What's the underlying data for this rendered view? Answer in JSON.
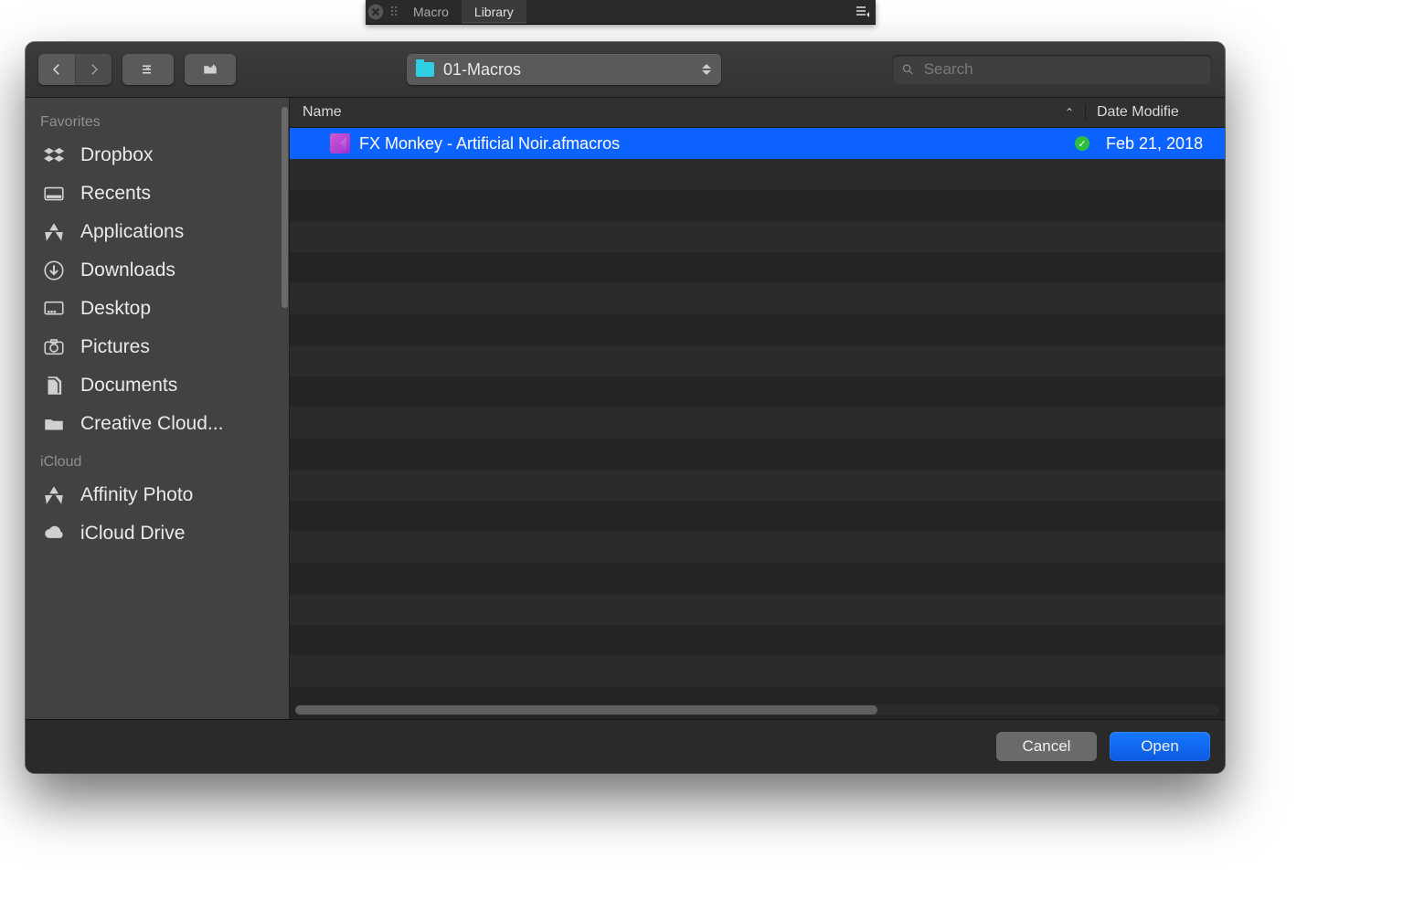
{
  "app_tabs": {
    "items": [
      "Macro",
      "Library"
    ],
    "active_index": 1
  },
  "toolbar": {
    "current_folder": "01-Macros",
    "search_placeholder": "Search"
  },
  "sidebar": {
    "sections": [
      {
        "header": "Favorites",
        "items": [
          {
            "icon": "dropbox",
            "label": "Dropbox"
          },
          {
            "icon": "recents",
            "label": "Recents"
          },
          {
            "icon": "applications",
            "label": "Applications"
          },
          {
            "icon": "downloads",
            "label": "Downloads"
          },
          {
            "icon": "desktop",
            "label": "Desktop"
          },
          {
            "icon": "pictures",
            "label": "Pictures"
          },
          {
            "icon": "documents",
            "label": "Documents"
          },
          {
            "icon": "folder",
            "label": "Creative Cloud..."
          }
        ]
      },
      {
        "header": "iCloud",
        "items": [
          {
            "icon": "applications",
            "label": "Affinity Photo"
          },
          {
            "icon": "cloud",
            "label": "iCloud Drive"
          }
        ]
      }
    ]
  },
  "columns": {
    "name": "Name",
    "date": "Date Modifie"
  },
  "files": [
    {
      "name": "FX Monkey - Artificial Noir.afmacros",
      "date": "Feb 21, 2018",
      "selected": true,
      "synced": true
    }
  ],
  "footer": {
    "cancel": "Cancel",
    "open": "Open"
  }
}
